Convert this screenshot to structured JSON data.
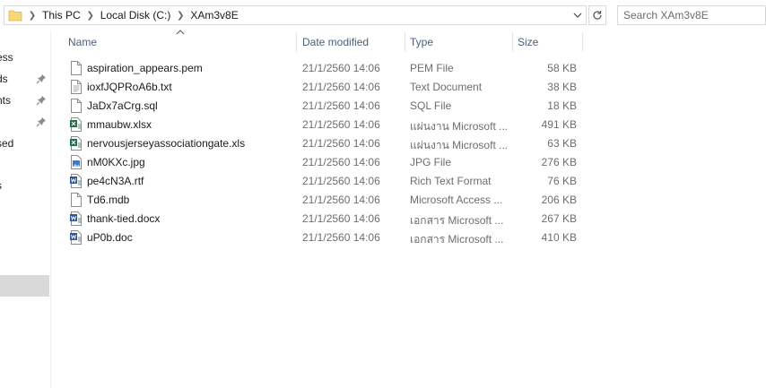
{
  "address": {
    "crumbs": [
      "This PC",
      "Local Disk (C:)",
      "XAm3v8E"
    ]
  },
  "search": {
    "placeholder": "Search XAm3v8E"
  },
  "nav": {
    "items": [
      {
        "label": "ess",
        "pinned": false
      },
      {
        "label": "ds",
        "pinned": true
      },
      {
        "label": "nts",
        "pinned": true
      },
      {
        "label": "",
        "pinned": true
      },
      {
        "label": "sed",
        "pinned": false
      },
      {
        "label": "s",
        "pinned": false
      }
    ]
  },
  "columns": {
    "name": "Name",
    "date": "Date modified",
    "type": "Type",
    "size": "Size"
  },
  "files": [
    {
      "name": "aspiration_appears.pem",
      "date": "21/1/2560 14:06",
      "type": "PEM File",
      "size": "58 KB",
      "icon": "generic-file-icon"
    },
    {
      "name": "ioxfJQPRoA6b.txt",
      "date": "21/1/2560 14:06",
      "type": "Text Document",
      "size": "38 KB",
      "icon": "text-file-icon"
    },
    {
      "name": "JaDx7aCrg.sql",
      "date": "21/1/2560 14:06",
      "type": "SQL File",
      "size": "18 KB",
      "icon": "generic-file-icon"
    },
    {
      "name": "mmaubw.xlsx",
      "date": "21/1/2560 14:06",
      "type": "แผ่นงาน Microsoft ...",
      "size": "491 KB",
      "icon": "excel-file-icon"
    },
    {
      "name": "nervousjerseyassociationgate.xls",
      "date": "21/1/2560 14:06",
      "type": "แผ่นงาน Microsoft ...",
      "size": "63 KB",
      "icon": "excel-file-icon"
    },
    {
      "name": "nM0KXc.jpg",
      "date": "21/1/2560 14:06",
      "type": "JPG File",
      "size": "276 KB",
      "icon": "image-file-icon"
    },
    {
      "name": "pe4cN3A.rtf",
      "date": "21/1/2560 14:06",
      "type": "Rich Text Format",
      "size": "76 KB",
      "icon": "word-file-icon"
    },
    {
      "name": "Td6.mdb",
      "date": "21/1/2560 14:06",
      "type": "Microsoft Access ...",
      "size": "206 KB",
      "icon": "generic-file-icon"
    },
    {
      "name": "thank-tied.docx",
      "date": "21/1/2560 14:06",
      "type": "เอกสาร Microsoft ...",
      "size": "267 KB",
      "icon": "word-file-icon"
    },
    {
      "name": "uP0b.doc",
      "date": "21/1/2560 14:06",
      "type": "เอกสาร Microsoft ...",
      "size": "410 KB",
      "icon": "word-file-icon"
    }
  ]
}
